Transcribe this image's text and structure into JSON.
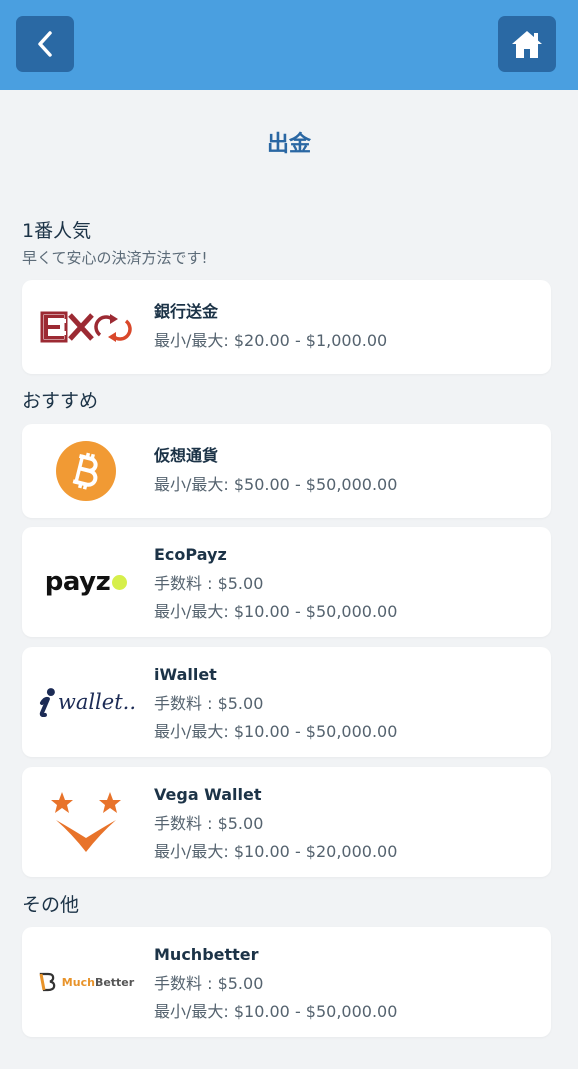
{
  "header": {
    "back_icon": "chevron-left-icon",
    "home_icon": "home-icon",
    "bar_color": "#4a9fe0",
    "button_color": "#2a69a4"
  },
  "page": {
    "title": "出金"
  },
  "sections": {
    "popular": {
      "title": "1番人気",
      "subtitle": "早くて安心の決済方法です!"
    },
    "recommended": {
      "title": "おすすめ"
    },
    "other": {
      "title": "その他"
    }
  },
  "methods": {
    "bank": {
      "name": "銀行送金",
      "limits": "最小/最大: $20.00 - $1,000.00",
      "logo": "ex-bank-logo"
    },
    "crypto": {
      "name": "仮想通貨",
      "limits": "最小/最大: $50.00 - $50,000.00",
      "logo": "bitcoin-logo"
    },
    "ecopayz": {
      "name": "EcoPayz",
      "fee": "手数料 : $5.00",
      "limits": "最小/最大: $10.00 - $50,000.00",
      "logo_text": "payz"
    },
    "iwallet": {
      "name": "iWallet",
      "fee": "手数料 : $5.00",
      "limits": "最小/最大: $10.00 - $50,000.00",
      "logo_text": "wallet.."
    },
    "vega": {
      "name": "Vega Wallet",
      "fee": "手数料 : $5.00",
      "limits": "最小/最大: $10.00 - $20,000.00",
      "logo": "vega-stars-logo"
    },
    "muchbetter": {
      "name": "Muchbetter",
      "fee": "手数料 : $5.00",
      "limits": "最小/最大: $10.00 - $50,000.00",
      "logo_text_a": "Much",
      "logo_text_b": "Better"
    }
  }
}
